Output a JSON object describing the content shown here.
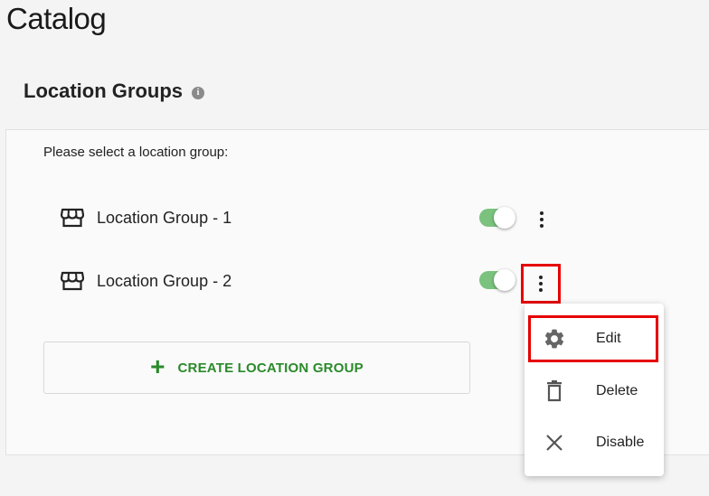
{
  "page": {
    "title": "Catalog"
  },
  "section": {
    "title": "Location Groups",
    "info_icon": "info-icon"
  },
  "card": {
    "prompt": "Please select a location group:",
    "groups": [
      {
        "label": "Location Group - 1",
        "enabled": true,
        "icon": "store-icon"
      },
      {
        "label": "Location Group - 2",
        "enabled": true,
        "icon": "store-icon"
      }
    ],
    "create_button": {
      "icon": "+",
      "label": "CREATE LOCATION GROUP"
    }
  },
  "context_menu": {
    "items": [
      {
        "label": "Edit",
        "icon": "gear-icon"
      },
      {
        "label": "Delete",
        "icon": "trash-icon"
      },
      {
        "label": "Disable",
        "icon": "close-icon"
      }
    ]
  },
  "colors": {
    "accent_green": "#2a8a2a",
    "toggle_on": "#7ac27e",
    "highlight": "#e60000"
  }
}
